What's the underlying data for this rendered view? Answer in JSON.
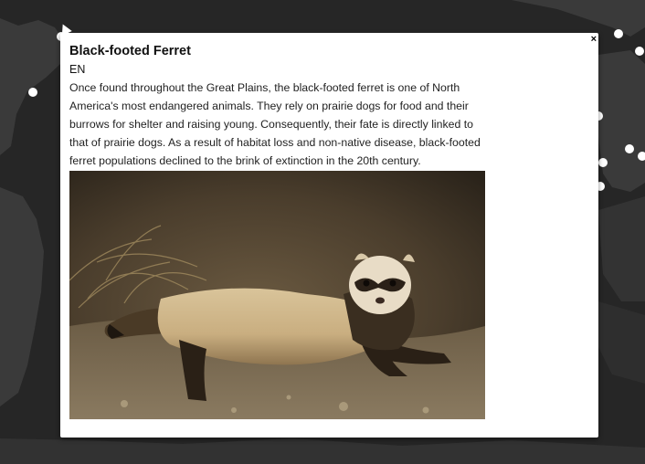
{
  "map": {
    "background": "#262626",
    "land_color": "#3b3b3b",
    "marker_color": "#ffffff"
  },
  "popup": {
    "close_label": "×",
    "title": "Black-footed Ferret",
    "status": "EN",
    "description": "Once found throughout the Great Plains, the black-footed ferret is one of North America's most endangered animals. They rely on prairie dogs for food and their burrows for shelter and raising young. Consequently, their fate is directly linked to that of prairie dogs. As a result of habitat loss and non-native disease, black-footed ferret populations declined to the brink of extinction in the 20th century.",
    "image_subject": "black-footed-ferret-photo"
  }
}
